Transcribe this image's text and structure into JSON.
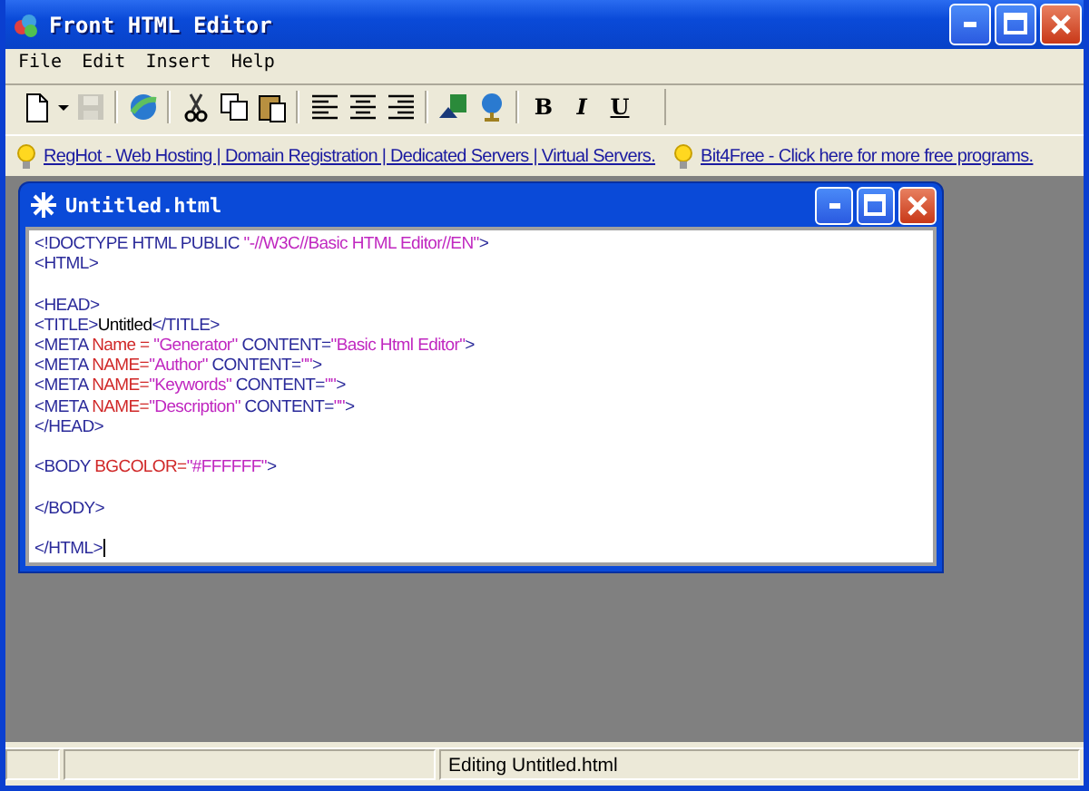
{
  "window": {
    "title": "Front HTML Editor"
  },
  "menu": [
    "File",
    "Edit",
    "Insert",
    "Help"
  ],
  "toolbar": [
    {
      "kind": "new",
      "disabled": false
    },
    {
      "kind": "caret",
      "disabled": false
    },
    {
      "kind": "save",
      "disabled": true
    },
    {
      "kind": "sep"
    },
    {
      "kind": "globe",
      "disabled": false
    },
    {
      "kind": "sep"
    },
    {
      "kind": "cut",
      "disabled": false
    },
    {
      "kind": "copy",
      "disabled": false
    },
    {
      "kind": "paste",
      "disabled": false
    },
    {
      "kind": "sep"
    },
    {
      "kind": "align-left",
      "disabled": false
    },
    {
      "kind": "align-center",
      "disabled": false
    },
    {
      "kind": "align-right",
      "disabled": false
    },
    {
      "kind": "sep"
    },
    {
      "kind": "preview",
      "disabled": false
    },
    {
      "kind": "globe-stand",
      "disabled": false
    },
    {
      "kind": "sep"
    },
    {
      "kind": "bold",
      "label": "B",
      "disabled": false
    },
    {
      "kind": "italic",
      "label": "I",
      "disabled": false
    },
    {
      "kind": "underline",
      "label": "U",
      "disabled": false
    }
  ],
  "links": [
    "RegHot - Web Hosting | Domain Registration | Dedicated Servers | Virtual Servers.",
    "Bit4Free - Click here for more free programs."
  ],
  "document": {
    "title": "Untitled.html",
    "blocks": [
      {
        "lines": [
          {
            "segments": [
              {
                "kind": "tag",
                "text": "<!DOCTYPE HTML PUBLIC "
              },
              {
                "kind": "value",
                "text": "\"-//W3C//Basic HTML Editor//EN\""
              },
              {
                "kind": "tag",
                "text": ">"
              }
            ]
          },
          {
            "segments": [
              {
                "kind": "tag",
                "text": "<HTML>"
              }
            ]
          }
        ]
      },
      {
        "lines": [
          {
            "segments": [
              {
                "kind": "tag",
                "text": "<HEAD>"
              }
            ]
          },
          {
            "segments": [
              {
                "kind": "tag",
                "text": "<TITLE>"
              },
              {
                "kind": "text",
                "text": "Untitled"
              },
              {
                "kind": "tag",
                "text": "</TITLE>"
              }
            ]
          },
          {
            "segments": [
              {
                "kind": "tag",
                "text": "<META "
              },
              {
                "kind": "attr",
                "text": "Name = "
              },
              {
                "kind": "value",
                "text": "\"Generator\""
              },
              {
                "kind": "tag",
                "text": " CONTENT="
              },
              {
                "kind": "value",
                "text": "\"Basic Html Editor\""
              },
              {
                "kind": "tag",
                "text": ">"
              }
            ]
          },
          {
            "segments": [
              {
                "kind": "tag",
                "text": "<META "
              },
              {
                "kind": "attr",
                "text": "NAME="
              },
              {
                "kind": "value",
                "text": "\"Author\""
              },
              {
                "kind": "tag",
                "text": " CONTENT="
              },
              {
                "kind": "value",
                "text": "\"\""
              },
              {
                "kind": "tag",
                "text": ">"
              }
            ]
          },
          {
            "segments": [
              {
                "kind": "tag",
                "text": "<META "
              },
              {
                "kind": "attr",
                "text": "NAME="
              },
              {
                "kind": "value",
                "text": "\"Keywords\""
              },
              {
                "kind": "tag",
                "text": " CONTENT="
              },
              {
                "kind": "value",
                "text": "\"\""
              },
              {
                "kind": "tag",
                "text": ">"
              }
            ]
          },
          {
            "segments": [
              {
                "kind": "tag",
                "text": "<META "
              },
              {
                "kind": "attr",
                "text": "NAME="
              },
              {
                "kind": "value",
                "text": "\"Description\""
              },
              {
                "kind": "tag",
                "text": " CONTENT="
              },
              {
                "kind": "value",
                "text": "\"\""
              },
              {
                "kind": "tag",
                "text": ">"
              }
            ]
          },
          {
            "segments": [
              {
                "kind": "tag",
                "text": "</HEAD>"
              }
            ]
          }
        ]
      },
      {
        "lines": [
          {
            "segments": [
              {
                "kind": "tag",
                "text": "<BODY "
              },
              {
                "kind": "attr",
                "text": "BGCOLOR="
              },
              {
                "kind": "value",
                "text": "\"#FFFFFF\""
              },
              {
                "kind": "tag",
                "text": ">"
              }
            ]
          }
        ]
      },
      {
        "lines": [
          {
            "segments": [
              {
                "kind": "tag",
                "text": "</BODY>"
              }
            ]
          }
        ]
      },
      {
        "lines": [
          {
            "segments": [
              {
                "kind": "tag",
                "text": "</HTML>"
              }
            ]
          }
        ]
      }
    ]
  },
  "status_bar": {
    "text": "Editing Untitled.html"
  }
}
